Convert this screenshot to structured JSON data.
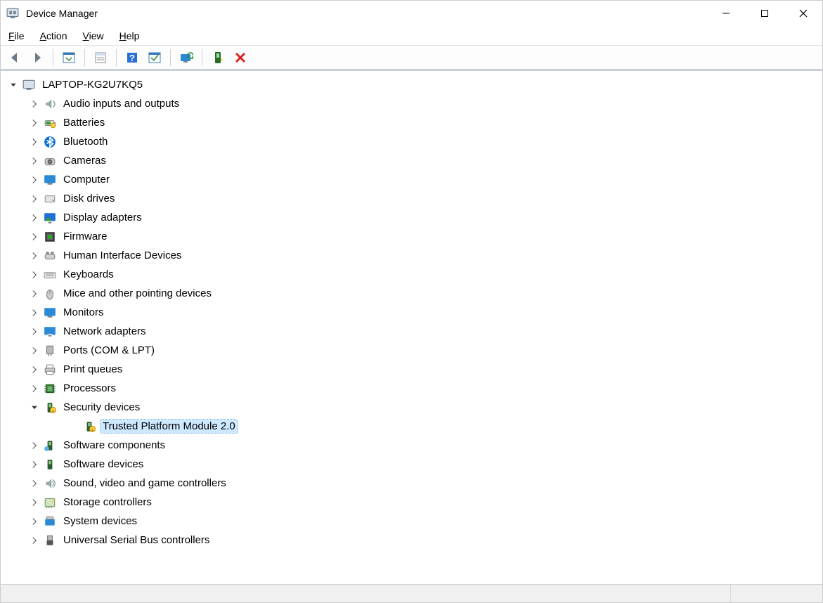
{
  "window": {
    "title": "Device Manager"
  },
  "menu": {
    "file": "File",
    "action": "Action",
    "view": "View",
    "help": "Help"
  },
  "toolbar": {
    "back": "Back",
    "forward": "Forward",
    "show_hide": "Show/Hide Console Tree",
    "properties": "Properties",
    "help": "Help",
    "update": "Update",
    "scan": "Scan for hardware changes",
    "add_driver": "Add drivers",
    "uninstall": "Uninstall"
  },
  "tree": {
    "root": "LAPTOP-KG2U7KQ5",
    "categories": [
      {
        "label": "Audio inputs and outputs",
        "icon": "audio-icon",
        "expanded": false
      },
      {
        "label": "Batteries",
        "icon": "battery-icon",
        "expanded": false
      },
      {
        "label": "Bluetooth",
        "icon": "bluetooth-icon",
        "expanded": false
      },
      {
        "label": "Cameras",
        "icon": "camera-icon",
        "expanded": false
      },
      {
        "label": "Computer",
        "icon": "computer-icon",
        "expanded": false
      },
      {
        "label": "Disk drives",
        "icon": "disk-icon",
        "expanded": false
      },
      {
        "label": "Display adapters",
        "icon": "display-adapter-icon",
        "expanded": false
      },
      {
        "label": "Firmware",
        "icon": "firmware-icon",
        "expanded": false
      },
      {
        "label": "Human Interface Devices",
        "icon": "hid-icon",
        "expanded": false
      },
      {
        "label": "Keyboards",
        "icon": "keyboard-icon",
        "expanded": false
      },
      {
        "label": "Mice and other pointing devices",
        "icon": "mouse-icon",
        "expanded": false
      },
      {
        "label": "Monitors",
        "icon": "monitor-icon",
        "expanded": false
      },
      {
        "label": "Network adapters",
        "icon": "network-icon",
        "expanded": false
      },
      {
        "label": "Ports (COM & LPT)",
        "icon": "port-icon",
        "expanded": false
      },
      {
        "label": "Print queues",
        "icon": "printer-icon",
        "expanded": false
      },
      {
        "label": "Processors",
        "icon": "processor-icon",
        "expanded": false
      },
      {
        "label": "Security devices",
        "icon": "security-icon",
        "expanded": true,
        "children": [
          {
            "label": "Trusted Platform Module 2.0",
            "icon": "tpm-icon",
            "selected": true
          }
        ]
      },
      {
        "label": "Software components",
        "icon": "software-component-icon",
        "expanded": false
      },
      {
        "label": "Software devices",
        "icon": "software-device-icon",
        "expanded": false
      },
      {
        "label": "Sound, video and game controllers",
        "icon": "sound-icon",
        "expanded": false
      },
      {
        "label": "Storage controllers",
        "icon": "storage-icon",
        "expanded": false
      },
      {
        "label": "System devices",
        "icon": "system-icon",
        "expanded": false
      },
      {
        "label": "Universal Serial Bus controllers",
        "icon": "usb-icon",
        "expanded": false
      }
    ]
  }
}
